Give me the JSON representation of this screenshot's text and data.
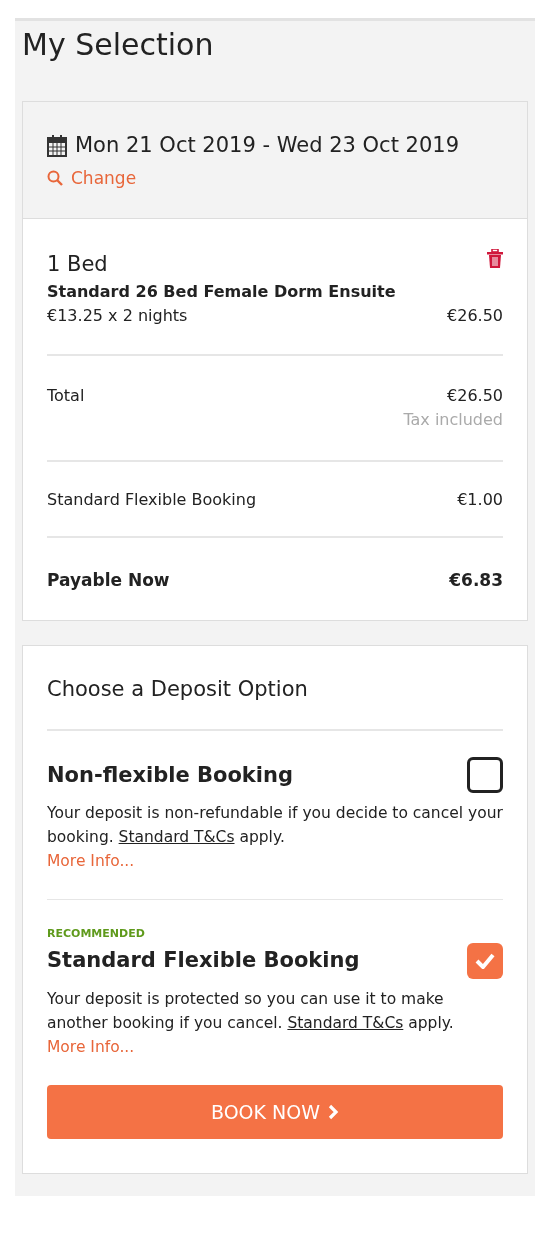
{
  "title": "My Selection",
  "dates": {
    "range": "Mon 21 Oct 2019 - Wed 23 Oct 2019",
    "change": "Change"
  },
  "item": {
    "quantity": "1 Bed",
    "room": "Standard 26 Bed Female Dorm Ensuite",
    "rate": "€13.25 x 2 nights",
    "amount": "€26.50"
  },
  "total": {
    "label": "Total",
    "amount": "€26.50",
    "note": "Tax included"
  },
  "extras": [
    {
      "label": "Standard Flexible Booking",
      "amount": "€1.00"
    }
  ],
  "payable": {
    "label": "Payable Now",
    "amount": "€6.83"
  },
  "deposit": {
    "heading": "Choose a Deposit Option",
    "options": [
      {
        "title": "Non-flexible Booking",
        "checked": false,
        "desc_before": "Your deposit is non-refundable if you decide to cancel your booking. ",
        "link": "Standard T&Cs",
        "desc_after": " apply.",
        "more": "More Info..."
      },
      {
        "tag": "RECOMMENDED",
        "title": "Standard Flexible Booking",
        "checked": true,
        "desc_before": "Your deposit is protected so you can use it to make another booking if you cancel. ",
        "link": "Standard T&Cs",
        "desc_after": " apply.",
        "more": "More Info..."
      }
    ],
    "button": "BOOK NOW"
  }
}
